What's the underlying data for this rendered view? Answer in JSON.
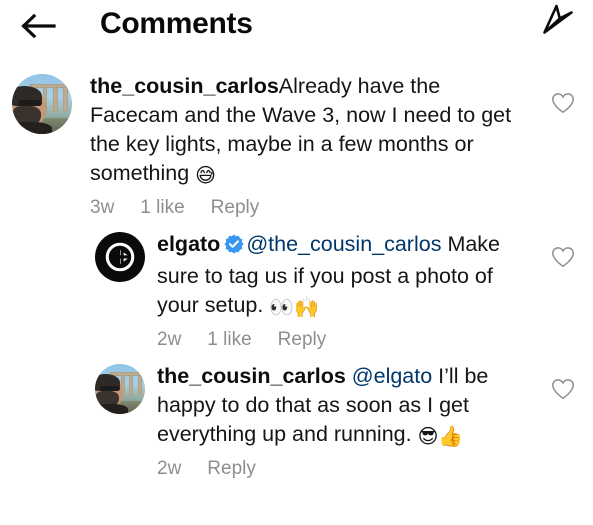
{
  "header": {
    "back_icon": "back-arrow-icon",
    "title": "Comments",
    "share_icon": "send-paper-plane-icon"
  },
  "comments": [
    {
      "id": "comment-1",
      "indent": "root",
      "avatar": "photo",
      "avatar_alt": "the_cousin_carlos profile photo",
      "username": "the_cousin_carlos",
      "verified": false,
      "mention": "",
      "text": "Already have the Facecam and the Wave 3, now I need to get the key lights, maybe in a few months or something ",
      "emoji": "😅",
      "time": "3w",
      "likes": "1 like",
      "reply_label": "Reply",
      "like_icon": "heart-outline-icon"
    },
    {
      "id": "comment-2",
      "indent": "reply",
      "avatar": "elgato",
      "avatar_alt": "elgato logo",
      "username": "elgato",
      "verified": true,
      "mention": "@the_cousin_carlos",
      "text": " Make sure to tag us if you post a photo of your setup. ",
      "emoji": "👀🙌",
      "time": "2w",
      "likes": "1 like",
      "reply_label": "Reply",
      "like_icon": "heart-outline-icon"
    },
    {
      "id": "comment-3",
      "indent": "reply",
      "avatar": "photo",
      "avatar_alt": "the_cousin_carlos profile photo",
      "username": "the_cousin_carlos",
      "verified": false,
      "mention": "@elgato",
      "text": " I’ll be happy to do that as soon as I get everything up and running. ",
      "emoji": "😎👍",
      "time": "2w",
      "likes": "",
      "reply_label": "Reply",
      "like_icon": "heart-outline-icon"
    }
  ],
  "colors": {
    "verified_blue": "#3897f0",
    "mention_blue": "#00376b",
    "meta_gray": "#8e8e8e",
    "text_black": "#151515",
    "background": "#ffffff"
  }
}
